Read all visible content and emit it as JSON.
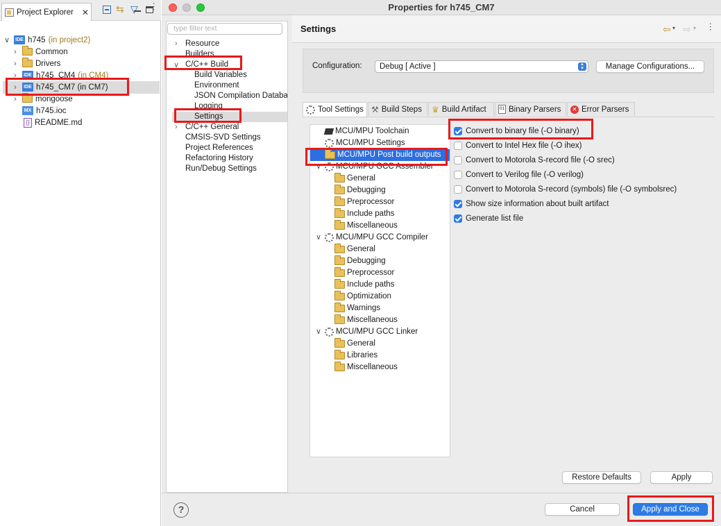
{
  "explorer": {
    "tab_label": "Project Explorer",
    "close_glyph": "✕",
    "tree": [
      {
        "name": "h745",
        "suffix": "(in project2)",
        "icon": "project-icon"
      },
      {
        "name": "Common",
        "suffix": "",
        "icon": "folder-icon"
      },
      {
        "name": "Drivers",
        "suffix": "",
        "icon": "folder-icon"
      },
      {
        "name": "h745_CM4",
        "suffix": "(in CM4)",
        "icon": "project-icon"
      },
      {
        "name": "h745_CM7 (in CM7)",
        "suffix": "",
        "icon": "project-icon"
      },
      {
        "name": "mongoose",
        "suffix": "",
        "icon": "folder-icon"
      },
      {
        "name": "h745.ioc",
        "suffix": "",
        "icon": "ioc-file-icon"
      },
      {
        "name": "README.md",
        "suffix": "",
        "icon": "markdown-file-icon"
      }
    ]
  },
  "dialog": {
    "title": "Properties for h745_CM7",
    "filter_placeholder": "type filter text",
    "nav": [
      "Resource",
      "Builders",
      "C/C++ Build",
      "Build Variables",
      "Environment",
      "JSON Compilation Databa",
      "Logging",
      "Settings",
      "C/C++ General",
      "CMSIS-SVD Settings",
      "Project References",
      "Refactoring History",
      "Run/Debug Settings"
    ],
    "section_title": "Settings",
    "configuration_label": "Configuration:",
    "configuration_value": "Debug  [ Active ]",
    "manage_button": "Manage Configurations...",
    "tabs": [
      "Tool Settings",
      "Build Steps",
      "Build Artifact",
      "Binary Parsers",
      "Error Parsers"
    ],
    "tool_tree": [
      "MCU/MPU Toolchain",
      "MCU/MPU Settings",
      "MCU/MPU Post build outputs",
      "MCU/MPU GCC Assembler",
      "General",
      "Debugging",
      "Preprocessor",
      "Include paths",
      "Miscellaneous",
      "MCU/MPU GCC Compiler",
      "General",
      "Debugging",
      "Preprocessor",
      "Include paths",
      "Optimization",
      "Warnings",
      "Miscellaneous",
      "MCU/MPU GCC Linker",
      "General",
      "Libraries",
      "Miscellaneous"
    ],
    "options": [
      {
        "label": "Convert to binary file (-O binary)",
        "checked": true
      },
      {
        "label": "Convert to Intel Hex file (-O ihex)",
        "checked": false
      },
      {
        "label": "Convert to Motorola S-record file (-O srec)",
        "checked": false
      },
      {
        "label": "Convert to Verilog file (-O verilog)",
        "checked": false
      },
      {
        "label": "Convert to Motorola S-record (symbols) file (-O symbolsrec)",
        "checked": false
      },
      {
        "label": "Show size information about built artifact",
        "checked": true
      },
      {
        "label": "Generate list file",
        "checked": true
      }
    ],
    "restore_defaults": "Restore Defaults",
    "apply": "Apply",
    "cancel": "Cancel",
    "apply_close": "Apply and Close",
    "help_glyph": "?"
  },
  "colors": {
    "highlight": "#e8191a",
    "selection": "#2d6fe0",
    "primary": "#2d7be5"
  }
}
